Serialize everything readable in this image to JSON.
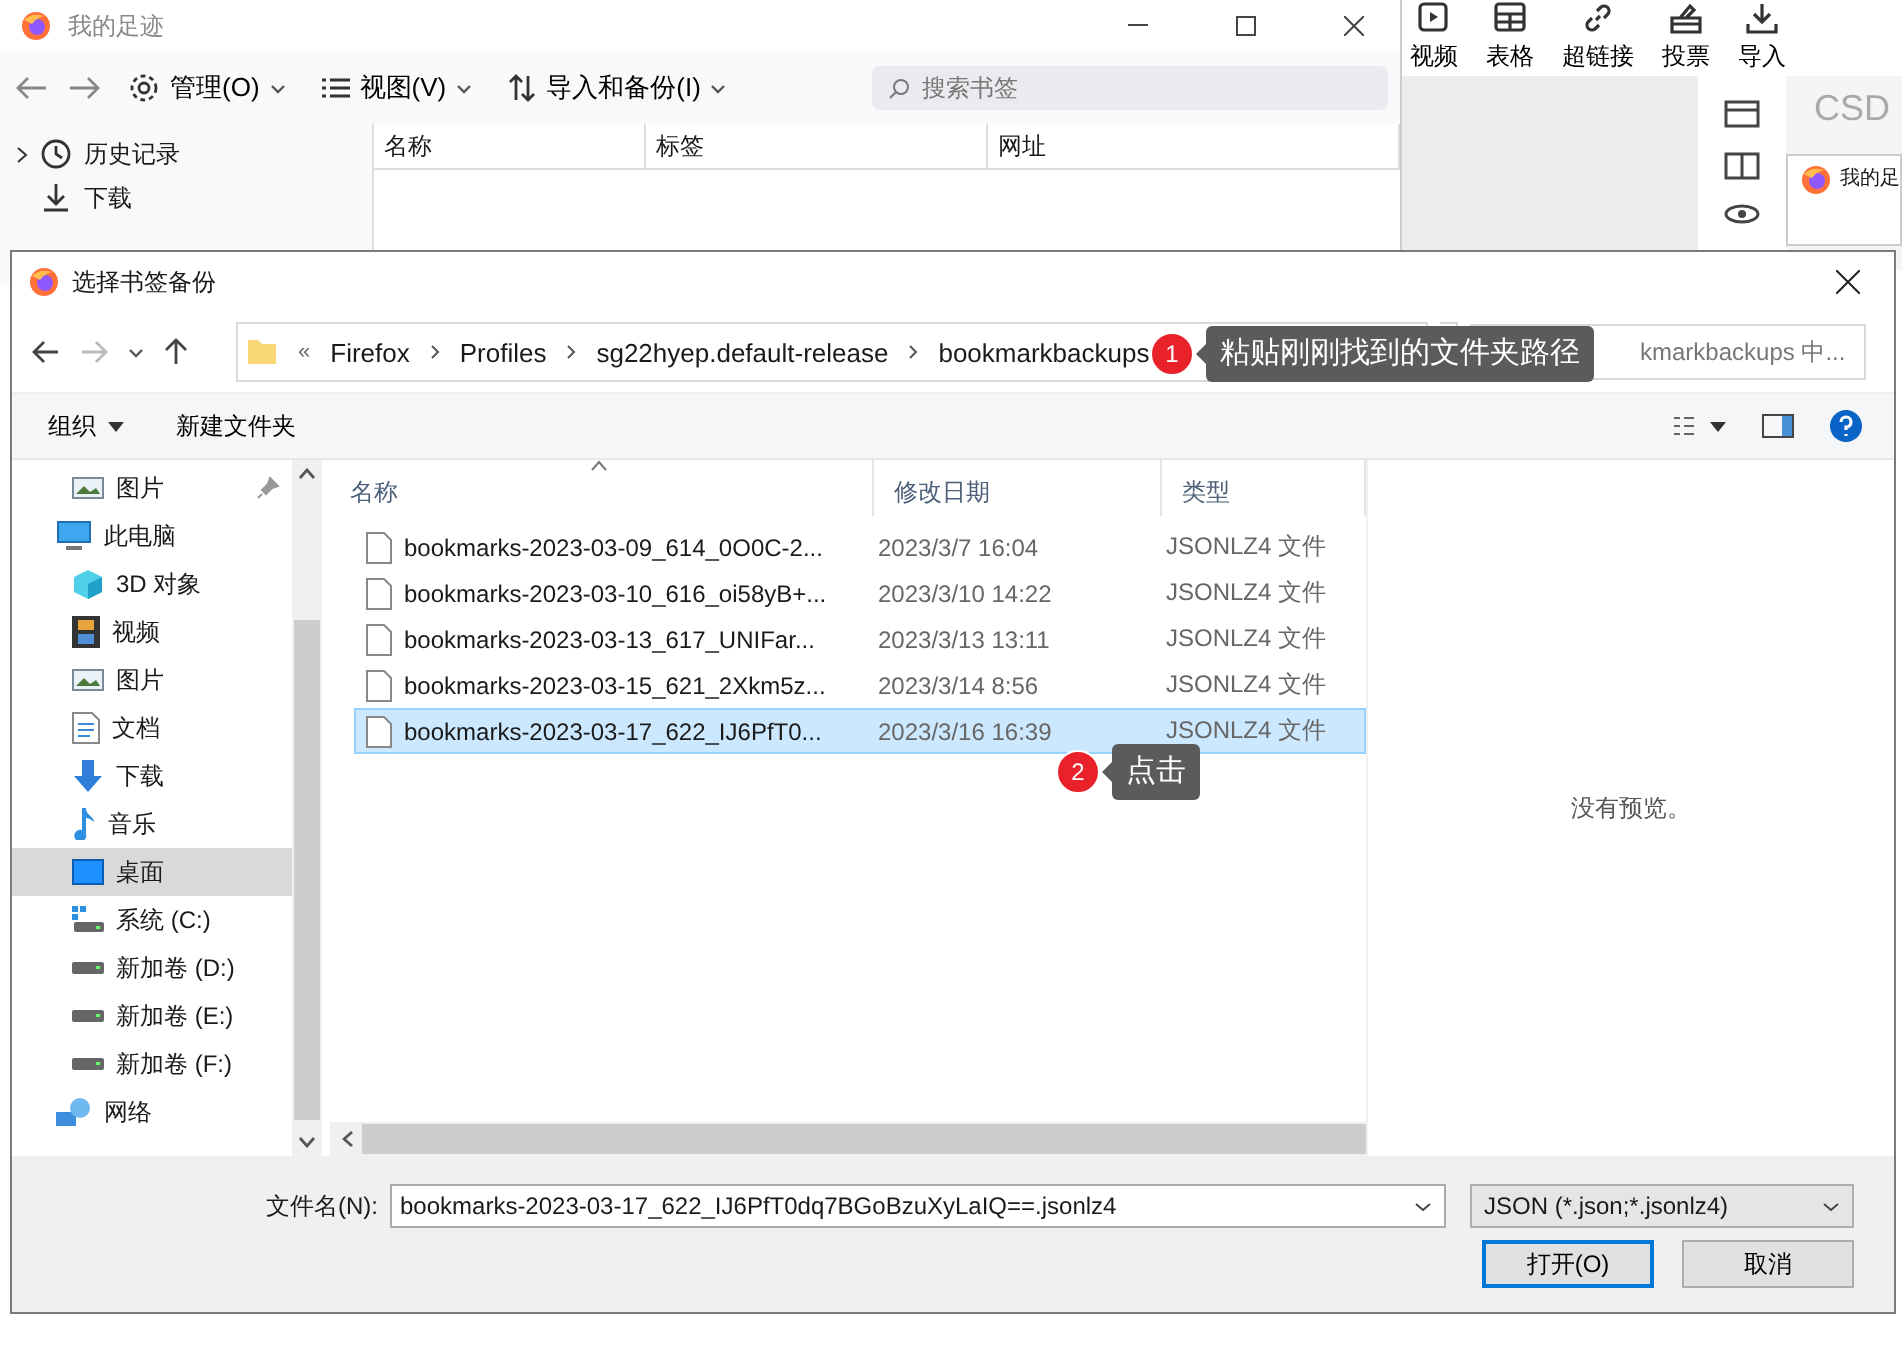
{
  "library_window": {
    "title": "我的足迹",
    "toolbar": [
      {
        "label": "管理(O)",
        "kind": "gear"
      },
      {
        "label": "视图(V)",
        "kind": "list"
      },
      {
        "label": "导入和备份(I)",
        "kind": "sort"
      }
    ],
    "search": {
      "placeholder": "搜索书签"
    },
    "sidebar": [
      {
        "label": "历史记录",
        "kind": "clock"
      },
      {
        "label": "下载",
        "kind": "download"
      }
    ],
    "columns": [
      "名称",
      "标签",
      "网址"
    ]
  },
  "editor": {
    "toolbar": [
      {
        "label": "视频",
        "kind": "video"
      },
      {
        "label": "表格",
        "kind": "table"
      },
      {
        "label": "超链接",
        "kind": "link"
      },
      {
        "label": "投票",
        "kind": "vote"
      },
      {
        "label": "导入",
        "kind": "import"
      }
    ],
    "side_label": "CSD",
    "mini_window_title": "我的足"
  },
  "dialog": {
    "title": "选择书签备份",
    "overflow": "«",
    "breadcrumb": [
      "Firefox",
      "Profiles",
      "sg22hyep.default-release",
      "bookmarkbackups"
    ],
    "search": {
      "placeholder": "kmarkbackups 中..."
    },
    "commands": [
      {
        "label": "组织",
        "dropdown": true
      },
      {
        "label": "新建文件夹",
        "dropdown": false
      }
    ],
    "nav": [
      {
        "label": "图片",
        "kind": "pictures",
        "selected": false,
        "pinned": true
      },
      {
        "label": "此电脑",
        "kind": "pc",
        "selected": false,
        "pinned": false
      },
      {
        "label": "3D 对象",
        "kind": "cube",
        "selected": false,
        "pinned": false
      },
      {
        "label": "视频",
        "kind": "video",
        "selected": false,
        "pinned": false
      },
      {
        "label": "图片",
        "kind": "pictures",
        "selected": false,
        "pinned": false
      },
      {
        "label": "文档",
        "kind": "document",
        "selected": false,
        "pinned": false
      },
      {
        "label": "下载",
        "kind": "download",
        "selected": false,
        "pinned": false
      },
      {
        "label": "音乐",
        "kind": "music",
        "selected": false,
        "pinned": false
      },
      {
        "label": "桌面",
        "kind": "desktop",
        "selected": true,
        "pinned": false
      },
      {
        "label": "系统 (C:)",
        "kind": "system_drive",
        "selected": false,
        "pinned": false
      },
      {
        "label": "新加卷 (D:)",
        "kind": "drive",
        "selected": false,
        "pinned": false
      },
      {
        "label": "新加卷 (E:)",
        "kind": "drive",
        "selected": false,
        "pinned": false
      },
      {
        "label": "新加卷 (F:)",
        "kind": "drive",
        "selected": false,
        "pinned": false
      },
      {
        "label": "网络",
        "kind": "network",
        "selected": false,
        "pinned": false
      }
    ],
    "columns": [
      "名称",
      "修改日期",
      "类型"
    ],
    "files": [
      {
        "name": "bookmarks-2023-03-09_614_0O0C-2...",
        "modified": "2023/3/7 16:04",
        "type": "JSONLZ4 文件",
        "selected": false
      },
      {
        "name": "bookmarks-2023-03-10_616_oi58yB+...",
        "modified": "2023/3/10 14:22",
        "type": "JSONLZ4 文件",
        "selected": false
      },
      {
        "name": "bookmarks-2023-03-13_617_UNIFar...",
        "modified": "2023/3/13 13:11",
        "type": "JSONLZ4 文件",
        "selected": false
      },
      {
        "name": "bookmarks-2023-03-15_621_2Xkm5z...",
        "modified": "2023/3/14 8:56",
        "type": "JSONLZ4 文件",
        "selected": false
      },
      {
        "name": "bookmarks-2023-03-17_622_IJ6PfT0...",
        "modified": "2023/3/16 16:39",
        "type": "JSONLZ4 文件",
        "selected": true
      }
    ],
    "preview": "没有预览。",
    "filename_label": "文件名(N):",
    "filename": "bookmarks-2023-03-17_622_IJ6PfT0dq7BGoBzuXyLaIQ==.jsonlz4",
    "filetype": "JSON (*.json;*.jsonlz4)",
    "buttons": [
      {
        "label": "打开(O)",
        "default": true
      },
      {
        "label": "取消",
        "default": false
      }
    ]
  },
  "annotations": [
    {
      "number": "1",
      "text": "粘贴刚刚找到的文件夹路径"
    },
    {
      "number": "2",
      "text": "点击"
    }
  ]
}
